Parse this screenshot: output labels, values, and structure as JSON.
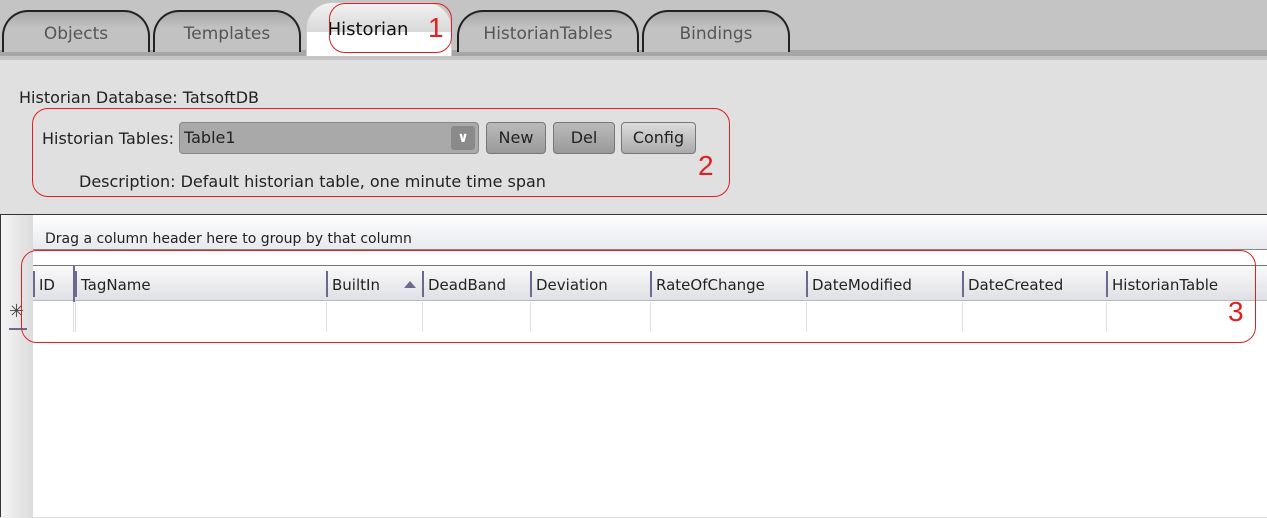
{
  "tabs": [
    {
      "label": "Objects"
    },
    {
      "label": "Templates"
    },
    {
      "label": "Historian",
      "active": true
    },
    {
      "label": "HistorianTables"
    },
    {
      "label": "Bindings"
    }
  ],
  "historian": {
    "database_label": "Historian Database: TatsoftDB",
    "tables_label": "Historian Tables:",
    "selected_table": "Table1",
    "new_label": "New",
    "del_label": "Del",
    "config_label": "Config",
    "description_label": "Description: Default historian table, one minute time span"
  },
  "grid": {
    "group_hint": "Drag a column header here to group by that column",
    "columns": [
      "ID",
      "TagName",
      "BuiltIn",
      "DeadBand",
      "Deviation",
      "RateOfChange",
      "DateModified",
      "DateCreated",
      "HistorianTable"
    ],
    "sorted_column": "BuiltIn",
    "sort_direction": "ascending",
    "new_row_marker": "✳"
  },
  "annotations": [
    "1",
    "2",
    "3"
  ],
  "colors": {
    "annotation": "#e02020",
    "accent": "#6a6a8e"
  }
}
